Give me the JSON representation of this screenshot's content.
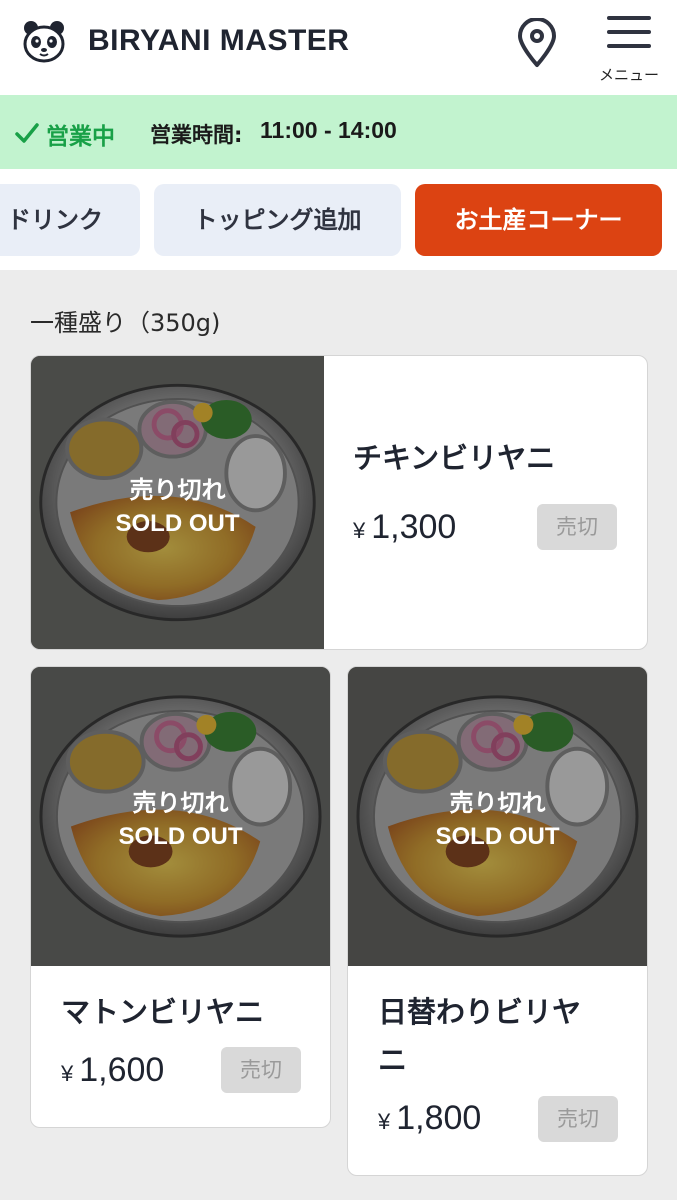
{
  "header": {
    "brand": "BIRYANI MASTER",
    "menu_label": "メニュー",
    "icons": {
      "logo": "panda-logo-icon",
      "location": "map-pin-icon",
      "menu": "hamburger-menu-icon"
    }
  },
  "status": {
    "open_label": "営業中",
    "hours_label": "営業時間:",
    "hours_value": "11:00 - 14:00",
    "icon": "check-icon",
    "color": "#18a047",
    "background": "#c2f3cf"
  },
  "categories": [
    {
      "label": "ドリンク",
      "active": false
    },
    {
      "label": "トッピング追加",
      "active": false
    },
    {
      "label": "お土産コーナー",
      "active": true
    }
  ],
  "accent_color": "#dc4312",
  "section": {
    "title": "一種盛り（350g)"
  },
  "products": [
    {
      "name": "チキンビリヤニ",
      "currency": "¥",
      "price": "1,300",
      "sold_out_jp": "売り切れ",
      "sold_out_en": "SOLD OUT",
      "status_button": "売切"
    },
    {
      "name": "マトンビリヤニ",
      "currency": "¥",
      "price": "1,600",
      "sold_out_jp": "売り切れ",
      "sold_out_en": "SOLD OUT",
      "status_button": "売切"
    },
    {
      "name": "日替わりビリヤニ",
      "currency": "¥",
      "price": "1,800",
      "sold_out_jp": "売り切れ",
      "sold_out_en": "SOLD OUT",
      "status_button": "売切"
    }
  ]
}
